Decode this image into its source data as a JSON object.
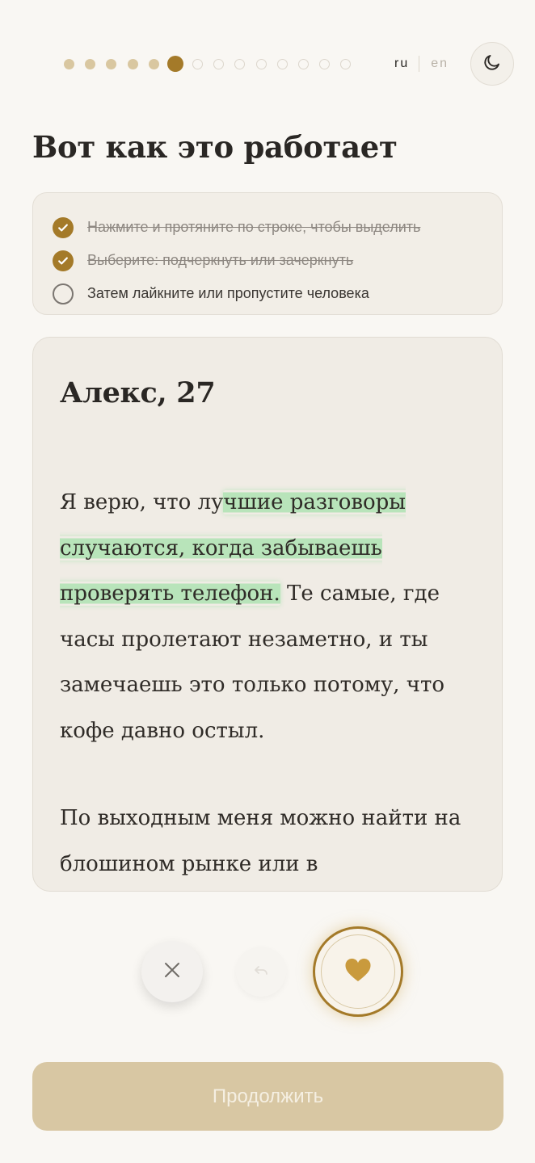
{
  "progress": {
    "total_steps": 14,
    "completed_steps": 5,
    "current_step": 6
  },
  "language": {
    "options": [
      "ru",
      "en"
    ],
    "selected": "ru"
  },
  "theme_toggle": {
    "icon": "moon-icon"
  },
  "title": "Вот как это работает",
  "checklist": [
    {
      "text": "Нажмите и протяните по строке, чтобы выделить",
      "done": true
    },
    {
      "text": "Выберите: подчеркнуть или зачеркнуть",
      "done": true
    },
    {
      "text": "Затем лайкните или пропустите человека",
      "done": false
    }
  ],
  "profile": {
    "name_age": "Алекс, 27",
    "paragraph1": {
      "before": "Я верю, что лу",
      "highlighted": "чшие разговоры случаются, когда забываешь проверять телефон.",
      "after": " Те самые, где часы пролетают незаметно, и ты замечаешь это только потому, что кофе давно остыл."
    },
    "paragraph2": "По выходным меня можно найти на блошином рынке или в"
  },
  "actions": {
    "skip_icon": "close-icon",
    "undo_icon": "undo-icon",
    "like_icon": "heart-icon"
  },
  "continue_label": "Продолжить",
  "colors": {
    "accent": "#a47a29",
    "highlight": "#8ade96",
    "background": "#f9f7f3",
    "continue_disabled": "#d8c7a3"
  }
}
